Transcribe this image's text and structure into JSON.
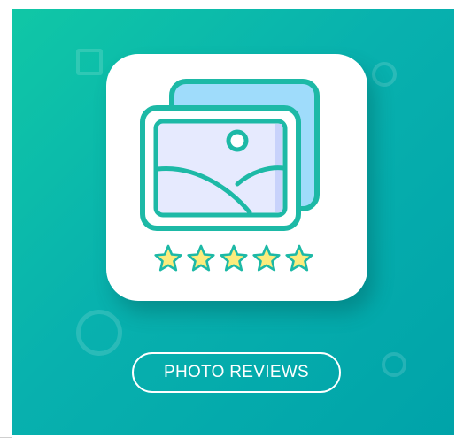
{
  "banner": {
    "button_label": "PHOTO REVIEWS",
    "rating": {
      "value": 5,
      "max": 5
    },
    "colors": {
      "background_start": "#10c7a6",
      "background_end": "#00a3a9",
      "icon_stroke": "#1db9a6",
      "photo_fill": "#e6eafe",
      "back_photo_fill": "#9fdcfb",
      "star_fill": "#fcec7c"
    },
    "icons": [
      "photo-gallery-icon",
      "star-icon"
    ]
  }
}
